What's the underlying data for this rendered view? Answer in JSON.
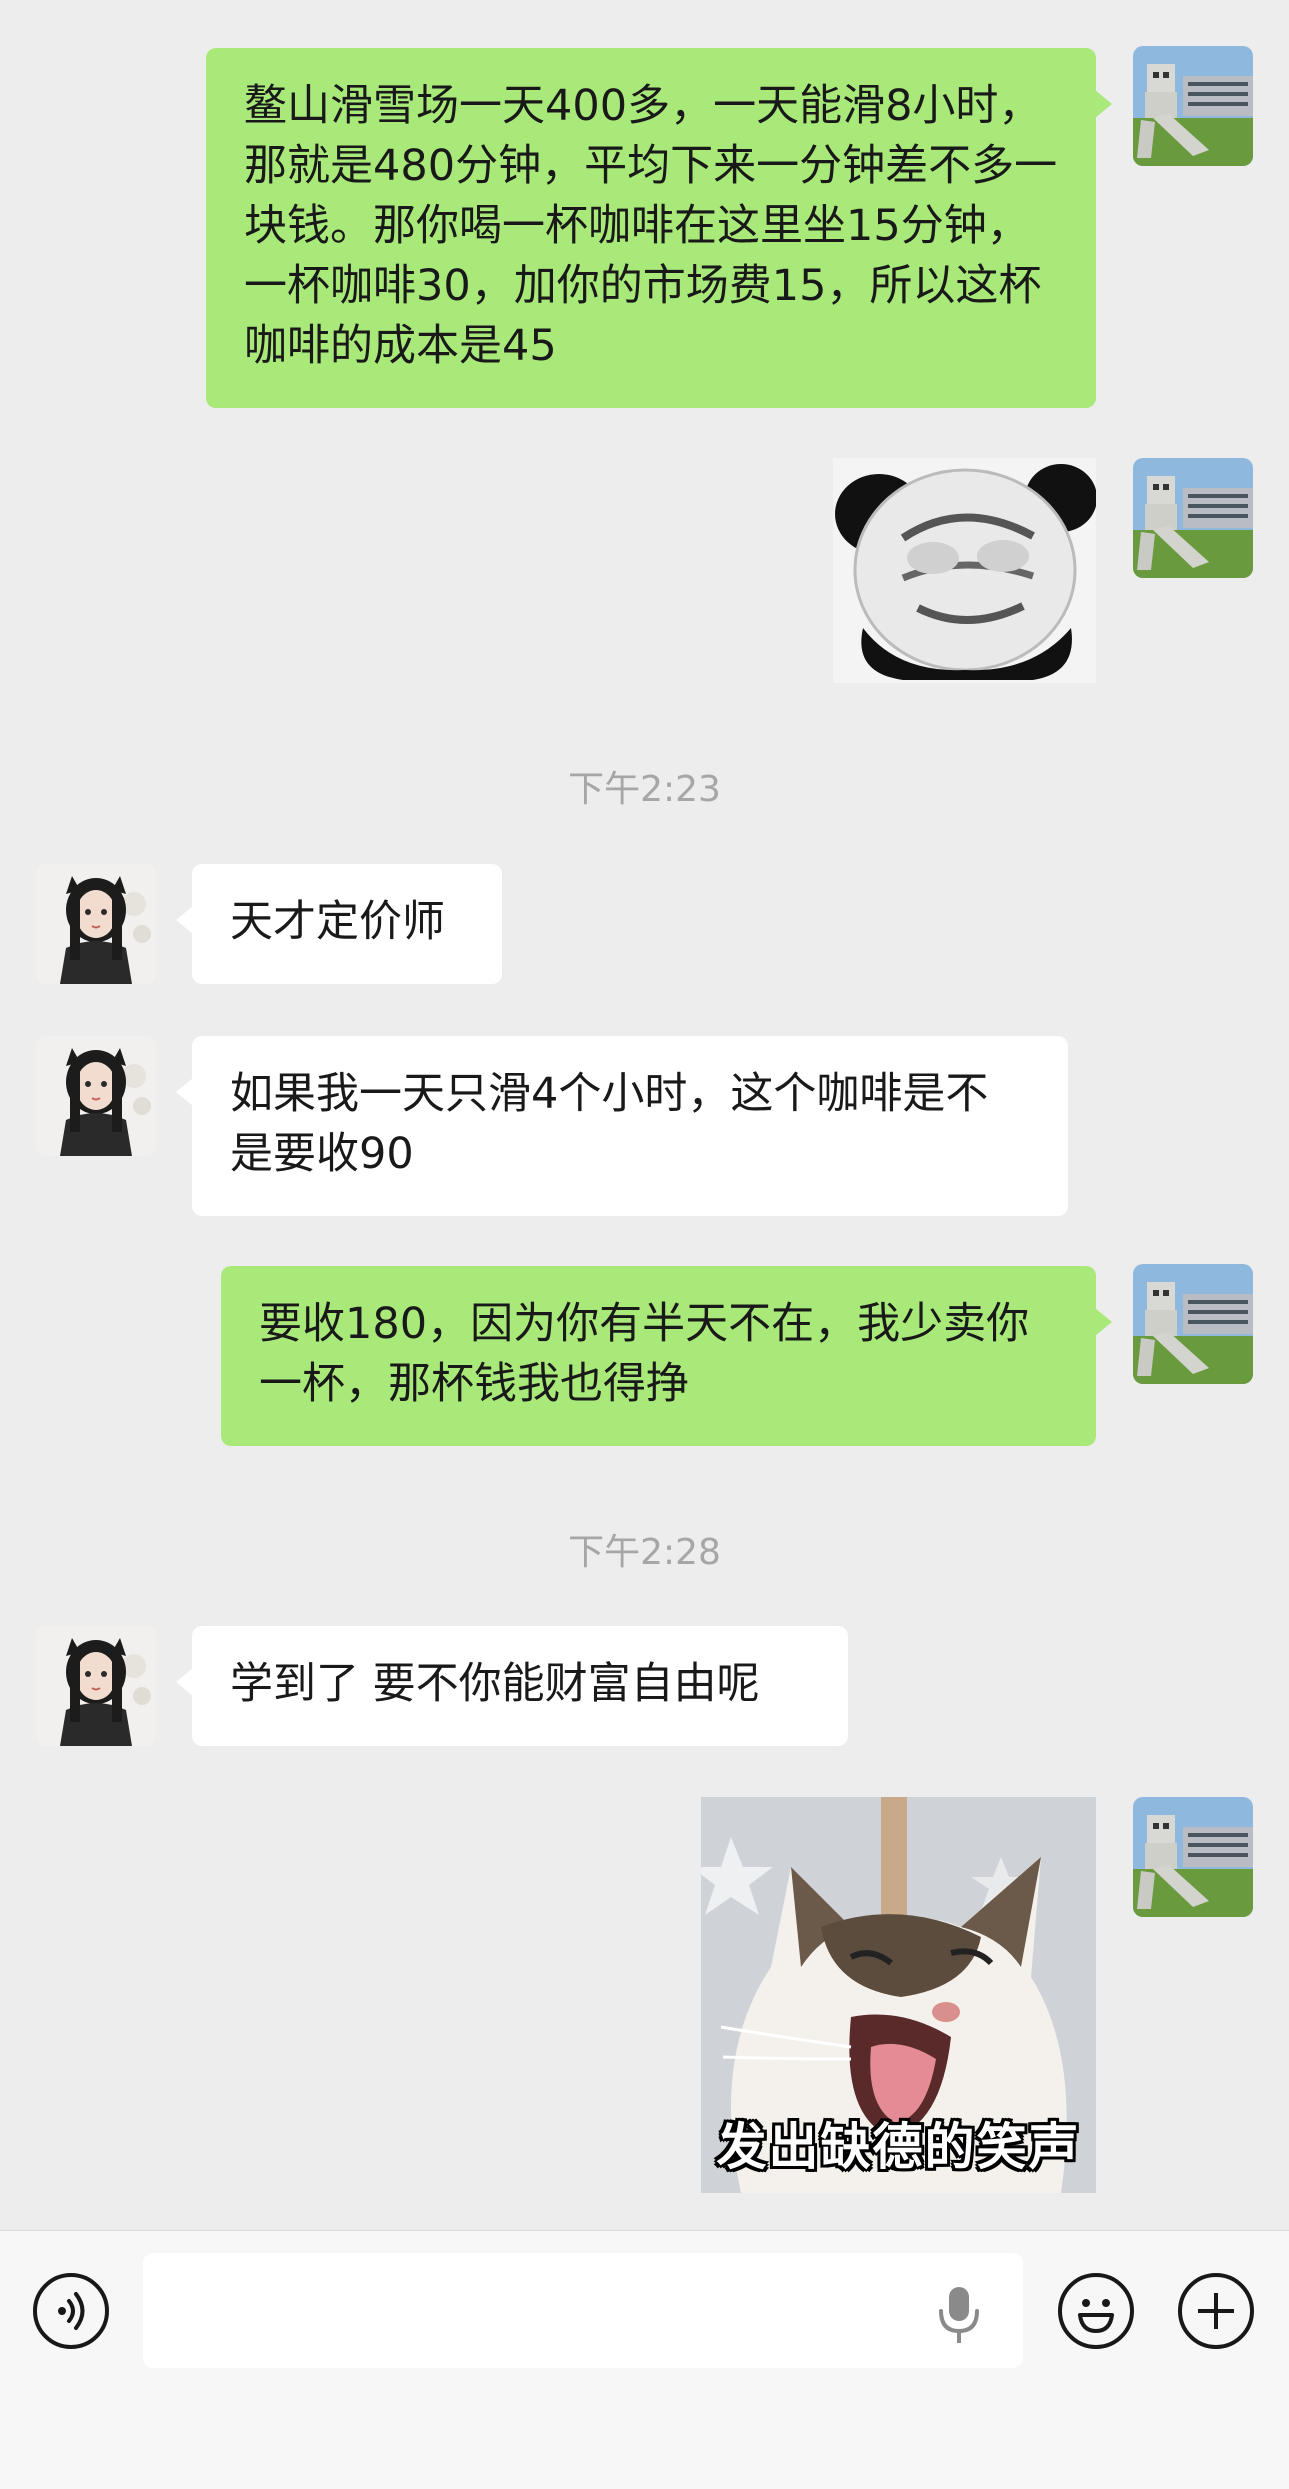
{
  "conversation": {
    "messages": [
      {
        "sender": "me",
        "type": "text",
        "text": "鳌山滑雪场一天400多，一天能滑8小时，那就是480分钟，平均下来一分钟差不多一块钱。那你喝一杯咖啡在这里坐15分钟，一杯咖啡30，加你的市场费15，所以这杯咖啡的成本是45"
      },
      {
        "sender": "me",
        "type": "sticker",
        "sticker": "panda-meme"
      },
      {
        "type": "timestamp",
        "text": "下午2:23"
      },
      {
        "sender": "them",
        "type": "text",
        "text": "天才定价师"
      },
      {
        "sender": "them",
        "type": "text",
        "text": "如果我一天只滑4个小时，这个咖啡是不是要收90"
      },
      {
        "sender": "me",
        "type": "text",
        "text": "要收180，因为你有半天不在，我少卖你一杯，那杯钱我也得挣"
      },
      {
        "type": "timestamp",
        "text": "下午2:28"
      },
      {
        "sender": "them",
        "type": "text",
        "text": "学到了 要不你能财富自由呢"
      },
      {
        "sender": "me",
        "type": "sticker",
        "sticker": "laughing-cat",
        "caption": "发出缺德的笑声"
      }
    ]
  },
  "input_bar": {
    "voice_icon": "voice-mode-icon",
    "input_value": "",
    "mic_icon": "microphone-icon",
    "emoji_icon": "emoji-icon",
    "plus_icon": "plus-icon"
  },
  "colors": {
    "my_bubble": "#a9e97a",
    "their_bubble": "#ffffff",
    "background": "#ededed",
    "timestamp": "#a6a6a6"
  }
}
